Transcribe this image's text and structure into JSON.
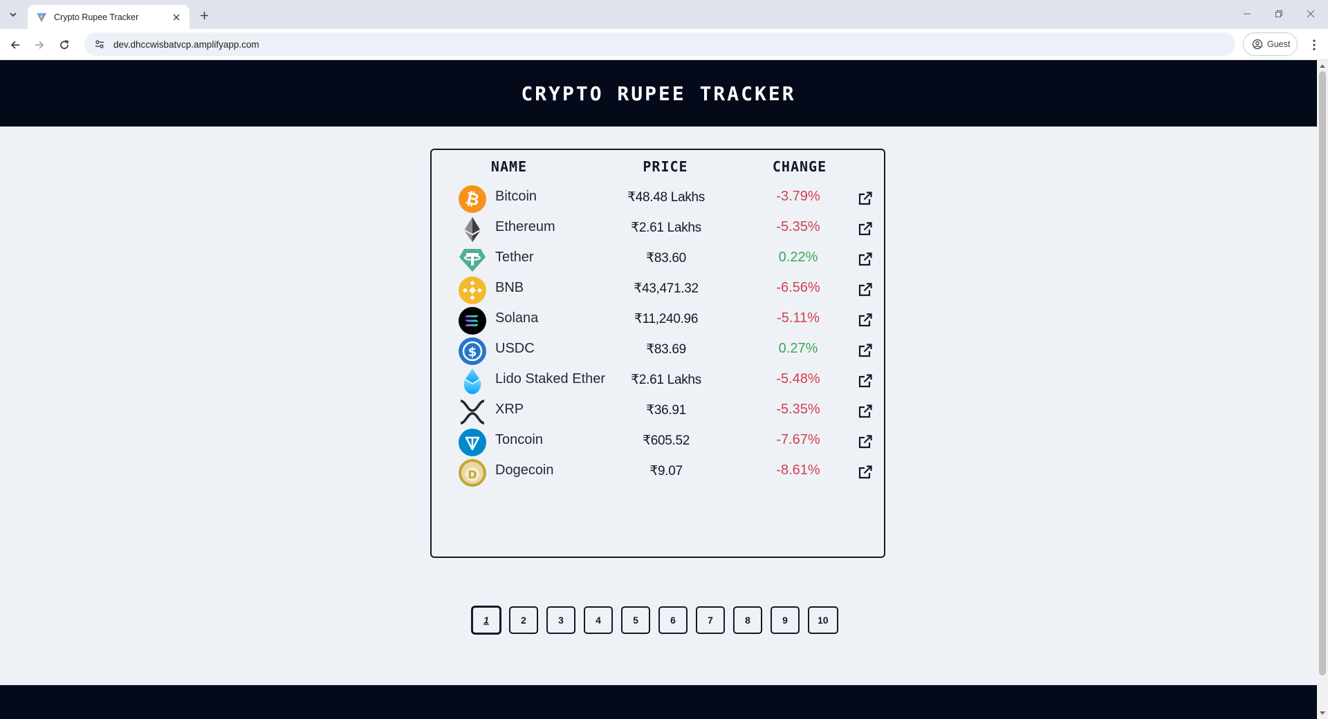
{
  "browser": {
    "tab_title": "Crypto Rupee Tracker",
    "url": "dev.dhccwisbatvcp.amplifyapp.com",
    "profile_label": "Guest"
  },
  "header": {
    "title": "CRYPTO RUPEE TRACKER"
  },
  "table": {
    "columns": {
      "name": "NAME",
      "price": "PRICE",
      "change": "CHANGE"
    },
    "rows": [
      {
        "name": "Bitcoin",
        "price": "₹48.48 Lakhs",
        "change": "-3.79%",
        "direction": "down",
        "icon": "bitcoin-icon",
        "color": "#f7931a"
      },
      {
        "name": "Ethereum",
        "price": "₹2.61 Lakhs",
        "change": "-5.35%",
        "direction": "down",
        "icon": "ethereum-icon",
        "color": "#3c3c3d"
      },
      {
        "name": "Tether",
        "price": "₹83.60",
        "change": "0.22%",
        "direction": "up",
        "icon": "tether-icon",
        "color": "#50af95"
      },
      {
        "name": "BNB",
        "price": "₹43,471.32",
        "change": "-6.56%",
        "direction": "down",
        "icon": "bnb-icon",
        "color": "#f3ba2f"
      },
      {
        "name": "Solana",
        "price": "₹11,240.96",
        "change": "-5.11%",
        "direction": "down",
        "icon": "solana-icon",
        "color": "#000000"
      },
      {
        "name": "USDC",
        "price": "₹83.69",
        "change": "0.27%",
        "direction": "up",
        "icon": "usdc-icon",
        "color": "#2775ca"
      },
      {
        "name": "Lido Staked Ether",
        "price": "₹2.61 Lakhs",
        "change": "-5.48%",
        "direction": "down",
        "icon": "lido-icon",
        "color": "#00a3ff"
      },
      {
        "name": "XRP",
        "price": "₹36.91",
        "change": "-5.35%",
        "direction": "down",
        "icon": "xrp-icon",
        "color": "#23292f"
      },
      {
        "name": "Toncoin",
        "price": "₹605.52",
        "change": "-7.67%",
        "direction": "down",
        "icon": "toncoin-icon",
        "color": "#0088cc"
      },
      {
        "name": "Dogecoin",
        "price": "₹9.07",
        "change": "-8.61%",
        "direction": "down",
        "icon": "dogecoin-icon",
        "color": "#c2a633"
      }
    ]
  },
  "pagination": {
    "current": "1",
    "pages": [
      "1",
      "2",
      "3",
      "4",
      "5",
      "6",
      "7",
      "8",
      "9",
      "10"
    ]
  },
  "colors": {
    "header_bg": "#040a1a",
    "page_bg": "#eef2f7",
    "negative": "#d43f4b",
    "positive": "#3aa655"
  }
}
